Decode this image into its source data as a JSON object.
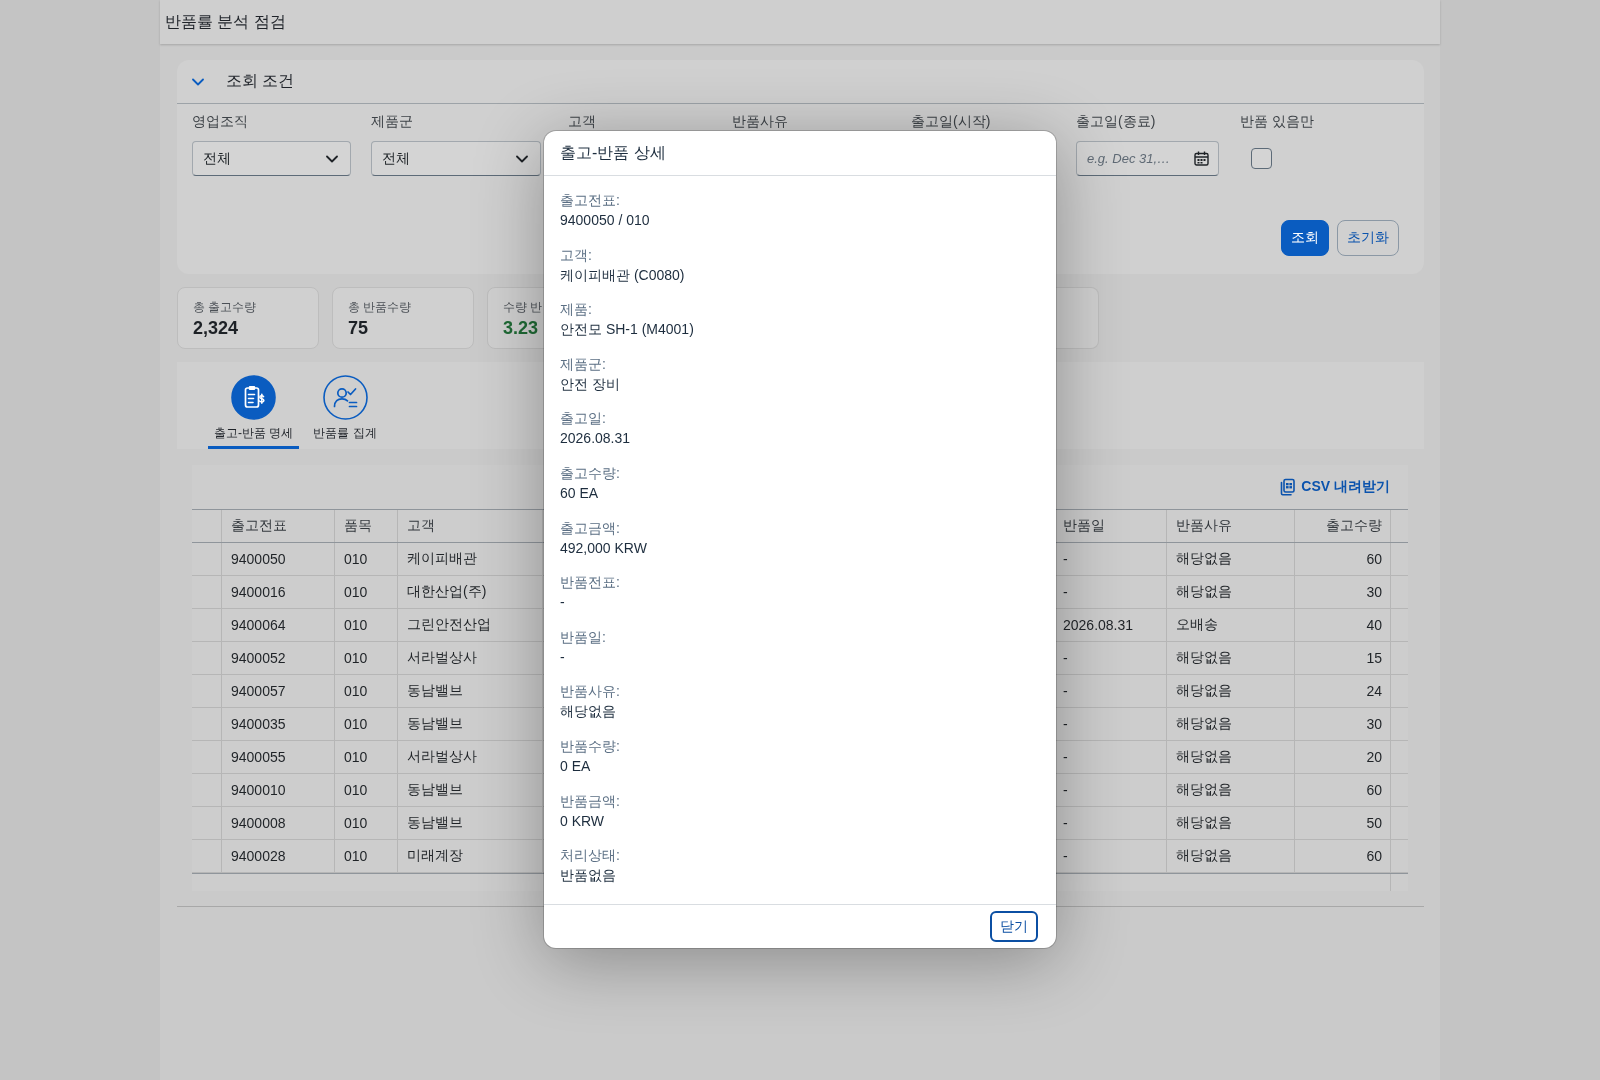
{
  "page": {
    "title": "반품률 분석 점검"
  },
  "filter_panel": {
    "title": "조회 조건",
    "expanded": true,
    "filters": [
      {
        "label": "영업조직",
        "kind": "select",
        "value": "전체"
      },
      {
        "label": "제품군",
        "kind": "select",
        "value": "전체"
      },
      {
        "label": "고객"
      },
      {
        "label": "반품사유"
      },
      {
        "label": "출고일(시작)"
      },
      {
        "label": "출고일(종료)",
        "kind": "date",
        "placeholder": "e.g. Dec 31,…"
      },
      {
        "label": "반품 있음만",
        "kind": "checkbox",
        "checked": false
      }
    ],
    "buttons": [
      {
        "label": "조회",
        "kind": "primary"
      },
      {
        "label": "초기화",
        "kind": "secondary"
      }
    ]
  },
  "kpis": [
    {
      "label": "총 출고수량",
      "value": "2,324",
      "color": "#1d2126"
    },
    {
      "label": "총 반품수량",
      "value": "75",
      "color": "#1d2126"
    },
    {
      "label": "수량 반",
      "value": "3.23",
      "color": "#1f6a35"
    }
  ],
  "tabs": [
    {
      "label": "출고-반품 명세",
      "selected": true
    },
    {
      "label": "반품률 집계",
      "selected": false
    }
  ],
  "table": {
    "action": "CSV 내려받기",
    "columns": [
      {
        "label": "출고전표",
        "kind": "text"
      },
      {
        "label": "품목",
        "kind": "text"
      },
      {
        "label": "고객",
        "kind": "text"
      },
      {
        "label": "반품일",
        "kind": "text"
      },
      {
        "label": "반품사유",
        "kind": "text"
      },
      {
        "label": "출고수량",
        "kind": "number"
      }
    ],
    "rows": [
      {
        "cells": [
          "9400050",
          "010",
          "케이피배관",
          "-",
          "해당없음",
          "60"
        ]
      },
      {
        "cells": [
          "9400016",
          "010",
          "대한산업(주)",
          "-",
          "해당없음",
          "30"
        ]
      },
      {
        "cells": [
          "9400064",
          "010",
          "그린안전산업",
          "2026.08.31",
          "오배송",
          "40"
        ]
      },
      {
        "cells": [
          "9400052",
          "010",
          "서라벌상사",
          "-",
          "해당없음",
          "15"
        ]
      },
      {
        "cells": [
          "9400057",
          "010",
          "동남밸브",
          "-",
          "해당없음",
          "24"
        ]
      },
      {
        "cells": [
          "9400035",
          "010",
          "동남밸브",
          "-",
          "해당없음",
          "30"
        ]
      },
      {
        "cells": [
          "9400055",
          "010",
          "서라벌상사",
          "-",
          "해당없음",
          "20"
        ]
      },
      {
        "cells": [
          "9400010",
          "010",
          "동남밸브",
          "-",
          "해당없음",
          "60"
        ]
      },
      {
        "cells": [
          "9400008",
          "010",
          "동남밸브",
          "-",
          "해당없음",
          "50"
        ]
      },
      {
        "cells": [
          "9400028",
          "010",
          "미래계장",
          "-",
          "해당없음",
          "60"
        ]
      }
    ]
  },
  "dialog": {
    "title": "출고-반품 상세",
    "fields": [
      {
        "label": "출고전표:",
        "value": "9400050 / 010"
      },
      {
        "label": "고객:",
        "value": "케이피배관 (C0080)"
      },
      {
        "label": "제품:",
        "value": "안전모 SH-1 (M4001)"
      },
      {
        "label": "제품군:",
        "value": "안전 장비"
      },
      {
        "label": "출고일:",
        "value": "2026.08.31"
      },
      {
        "label": "출고수량:",
        "value": "60 EA"
      },
      {
        "label": "출고금액:",
        "value": "492,000 KRW"
      },
      {
        "label": "반품전표:",
        "value": "-"
      },
      {
        "label": "반품일:",
        "value": "-"
      },
      {
        "label": "반품사유:",
        "value": "해당없음"
      },
      {
        "label": "반품수량:",
        "value": "0 EA"
      },
      {
        "label": "반품금액:",
        "value": "0 KRW"
      },
      {
        "label": "처리상태:",
        "value": "반품없음"
      }
    ],
    "close_button": "닫기"
  }
}
